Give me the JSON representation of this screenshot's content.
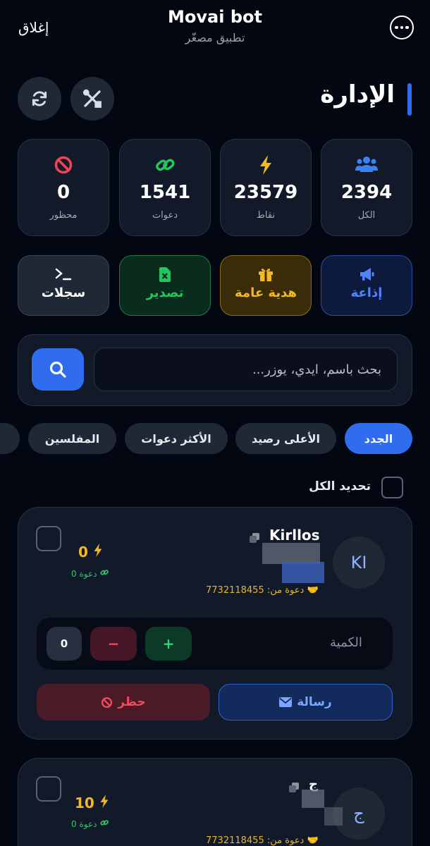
{
  "header": {
    "close_label": "إغلاق",
    "title": "Movai bot",
    "subtitle": "تطبيق مصغّر"
  },
  "section": {
    "title": "الإدارة"
  },
  "stats": [
    {
      "label": "الكل",
      "value": "2394",
      "icon": "users-icon",
      "color": "#3b82f6"
    },
    {
      "label": "نقاط",
      "value": "23579",
      "icon": "bolt-icon",
      "color": "#f5b81f"
    },
    {
      "label": "دعوات",
      "value": "1541",
      "icon": "link-icon",
      "color": "#22c55e"
    },
    {
      "label": "محظور",
      "value": "0",
      "icon": "ban-icon",
      "color": "#ef4458"
    }
  ],
  "actions": [
    {
      "label": "إذاعة",
      "icon": "megaphone-icon",
      "color": "#4f86ff"
    },
    {
      "label": "هدية عامة",
      "icon": "gift-icon",
      "color": "#f5b81f"
    },
    {
      "label": "تصدير",
      "icon": "excel-icon",
      "color": "#22c55e"
    },
    {
      "label": "سجلات",
      "icon": "terminal-icon",
      "color": "#ffffff"
    }
  ],
  "search": {
    "placeholder": "بحث باسم، ايدي، يوزر..."
  },
  "filters": [
    {
      "label": "الجدد",
      "active": true
    },
    {
      "label": "الأعلى رصيد",
      "active": false
    },
    {
      "label": "الأكثر دعوات",
      "active": false
    },
    {
      "label": "المفلسين",
      "active": false
    }
  ],
  "select_all_label": "تحديد الكل",
  "users": [
    {
      "name": "Kirllos",
      "avatar": "KI",
      "invited_by": "دعوة من: 7732118455",
      "points": "0",
      "invites": "0 دعوة",
      "qty_label": "الكمية",
      "qty_value": "0",
      "message_label": "رسالة",
      "ban_label": "حظر"
    },
    {
      "name": "ج",
      "avatar": "ج",
      "invited_by": "دعوة من: 7732118455",
      "points": "10",
      "invites": "0 دعوة"
    }
  ],
  "colors": {
    "background": "#030712",
    "card": "#121a2a",
    "accent": "#2f6cf0"
  }
}
